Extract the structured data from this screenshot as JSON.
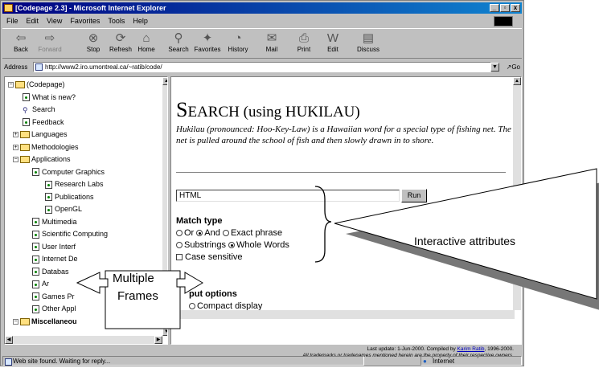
{
  "window": {
    "title": "[Codepage 2.3] - Microsoft Internet Explorer",
    "controls": [
      "_",
      "▫",
      "x"
    ]
  },
  "menu": [
    "File",
    "Edit",
    "View",
    "Favorites",
    "Tools",
    "Help"
  ],
  "toolbar": [
    {
      "label": "Back",
      "icon": "back-arrow-icon",
      "glyph": "⇦"
    },
    {
      "label": "Forward",
      "icon": "forward-arrow-icon",
      "glyph": "⇨"
    },
    {
      "label": "Stop",
      "icon": "stop-icon",
      "glyph": "⊗"
    },
    {
      "label": "Refresh",
      "icon": "refresh-icon",
      "glyph": "⟳"
    },
    {
      "label": "Home",
      "icon": "home-icon",
      "glyph": "⌂"
    },
    {
      "label": "Search",
      "icon": "search-icon",
      "glyph": "⚲"
    },
    {
      "label": "Favorites",
      "icon": "favorites-icon",
      "glyph": "✦"
    },
    {
      "label": "History",
      "icon": "history-icon",
      "glyph": "◔"
    },
    {
      "label": "Mail",
      "icon": "mail-icon",
      "glyph": "✉"
    },
    {
      "label": "Print",
      "icon": "print-icon",
      "glyph": "⎙"
    },
    {
      "label": "Edit",
      "icon": "edit-icon",
      "glyph": "W"
    },
    {
      "label": "Discuss",
      "icon": "discuss-icon",
      "glyph": "▤"
    }
  ],
  "address": {
    "label": "Address",
    "url": "http://www2.iro.umontreal.ca/~ratib/code/",
    "go": "Go"
  },
  "tree": [
    {
      "label": "(Codepage)",
      "kind": "folder-open",
      "expander": "−"
    },
    {
      "label": "What is new?",
      "kind": "doc"
    },
    {
      "label": "Search",
      "kind": "magnifier"
    },
    {
      "label": "Feedback",
      "kind": "doc"
    },
    {
      "label": "Languages",
      "kind": "folder",
      "expander": "+"
    },
    {
      "label": "Methodologies",
      "kind": "folder",
      "expander": "+"
    },
    {
      "label": "Applications",
      "kind": "folder-open",
      "expander": "−"
    },
    {
      "label": "Computer Graphics",
      "kind": "doc"
    },
    {
      "label": "Research Labs",
      "kind": "doc"
    },
    {
      "label": "Publications",
      "kind": "doc"
    },
    {
      "label": "OpenGL",
      "kind": "doc"
    },
    {
      "label": "Multimedia",
      "kind": "doc"
    },
    {
      "label": "Scientific Computing",
      "kind": "doc"
    },
    {
      "label": "User Interf",
      "kind": "doc"
    },
    {
      "label": "Internet De",
      "kind": "doc"
    },
    {
      "label": "Databas",
      "kind": "doc"
    },
    {
      "label": "Ar",
      "kind": "doc"
    },
    {
      "label": "Games Pr",
      "kind": "doc"
    },
    {
      "label": "Other Appl",
      "kind": "doc"
    },
    {
      "label": "Miscellaneou",
      "kind": "folder",
      "expander": "−"
    }
  ],
  "page": {
    "title_first": "S",
    "title_rest": "EARCH (using HUKILAU)",
    "description": "Hukilau (pronounced: Hoo-Key-Law) is a Hawaiian word for a special type of fishing net. The net is pulled around the school of fish and then slowly drawn in to shore.",
    "search_value": "HTML",
    "run": "Run",
    "match_type": "Match type",
    "options_row1": [
      {
        "label": "Or",
        "checked": false
      },
      {
        "label": "And",
        "checked": true
      },
      {
        "label": "Exact phrase",
        "checked": false
      }
    ],
    "options_row2": [
      {
        "label": "Substrings",
        "checked": false
      },
      {
        "label": "Whole Words",
        "checked": true
      }
    ],
    "case_sensitive": "Case sensitive",
    "output_options": "put options",
    "compact": "Compact display"
  },
  "footer": {
    "update": "Last update: 1-Jun-2000.  Compiled by",
    "author": "Karim Ratib",
    "years": ", 1996-2000.",
    "trademarks": "All trademarks or tradenames mentioned herein are the property of their respective owners."
  },
  "status": {
    "message": "Web site found. Waiting for reply...",
    "zone": "Internet"
  },
  "annotations": {
    "interactive": "Interactive attributes",
    "frames_line1": "Multiple",
    "frames_line2": "Frames"
  }
}
